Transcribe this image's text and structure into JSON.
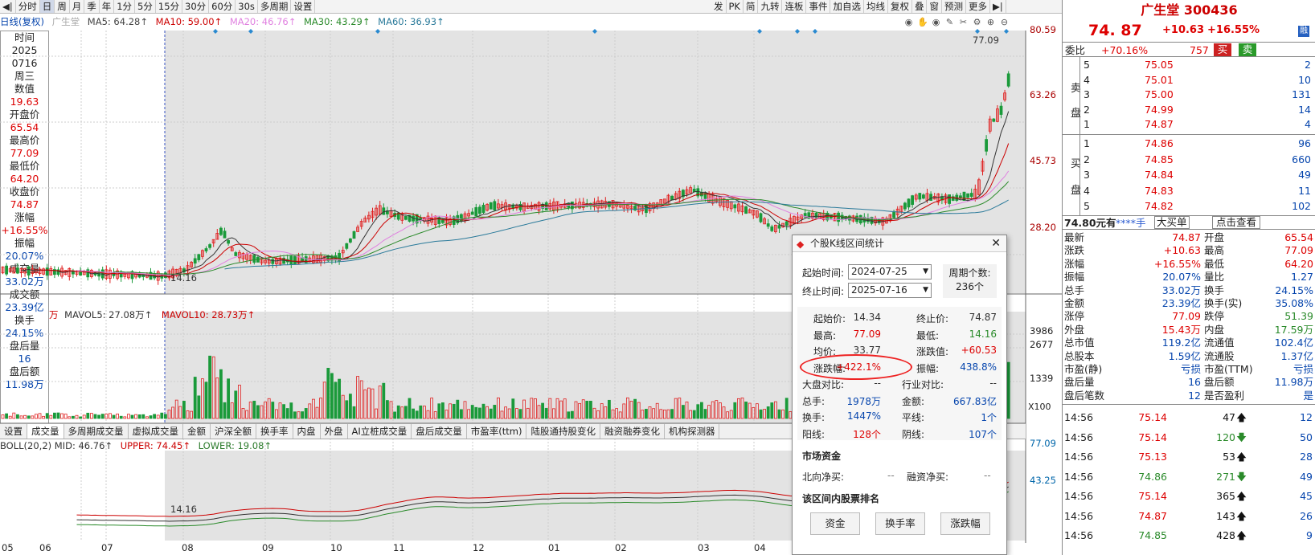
{
  "toolbar": {
    "items": [
      "分时",
      "日",
      "周",
      "月",
      "季",
      "年",
      "1分",
      "5分",
      "15分",
      "30分",
      "60分",
      "30s",
      "多周期",
      "设置"
    ],
    "active": "日",
    "right_items": [
      "发",
      "PK",
      "简",
      "九转",
      "连板",
      "事件",
      "加自选",
      "均线",
      "复权",
      "叠",
      "窗",
      "预测",
      "更多"
    ]
  },
  "stock": {
    "name": "广生堂",
    "code": "300436",
    "price": "74. 87",
    "change": "+10.63",
    "pct": "+16.55%",
    "tag": "融"
  },
  "ma_bar": {
    "label": "日线(复权)",
    "name": "广生堂",
    "ma5": "MA5: 64.28↑",
    "ma10": "MA10: 59.00↑",
    "ma20": "MA20: 46.76↑",
    "ma30": "MA30: 43.29↑",
    "ma60": "MA60: 36.93↑"
  },
  "left_info": [
    [
      "时间",
      ""
    ],
    [
      "2025",
      ""
    ],
    [
      "0716",
      ""
    ],
    [
      "周三",
      ""
    ],
    [
      "数值",
      ""
    ],
    [
      "19.63",
      "red"
    ],
    [
      "开盘价",
      ""
    ],
    [
      "65.54",
      "red"
    ],
    [
      "最高价",
      ""
    ],
    [
      "77.09",
      "red"
    ],
    [
      "最低价",
      ""
    ],
    [
      "64.20",
      "red"
    ],
    [
      "收盘价",
      ""
    ],
    [
      "74.87",
      "red"
    ],
    [
      "涨幅",
      ""
    ],
    [
      "+16.55%",
      "red"
    ],
    [
      "振幅",
      ""
    ],
    [
      "20.07%",
      "blue"
    ],
    [
      "成交量",
      ""
    ],
    [
      "33.02万",
      "blue"
    ],
    [
      "成交额",
      ""
    ],
    [
      "23.39亿",
      "blue"
    ],
    [
      "换手",
      ""
    ],
    [
      "24.15%",
      "blue"
    ],
    [
      "盘后量",
      ""
    ],
    [
      "16",
      "blue"
    ],
    [
      "盘后额",
      ""
    ],
    [
      "11.98万",
      "blue"
    ]
  ],
  "price_axis": [
    "80.59",
    "63.26",
    "45.73",
    "28.20"
  ],
  "price_annot": {
    "high": "77.09",
    "low": "14.16"
  },
  "vol_bar": {
    "unit": "万",
    "mavol5": "MAVOL5: 27.08万↑",
    "mavol10": "MAVOL10: 28.73万↑"
  },
  "vol_axis": [
    "3986",
    "2677",
    "1339"
  ],
  "vol_mult": "X100",
  "tabs": [
    "设置",
    "成交量",
    "多周期成交量",
    "虚拟成交量",
    "金额",
    "沪深全额",
    "换手率",
    "内盘",
    "外盘",
    "AI立桩成交量",
    "盘后成交量",
    "市盈率(ttm)",
    "陆股通持股变化",
    "融资融券变化",
    "机构探测器"
  ],
  "boll": {
    "mid": "BOLL(20,2) MID: 46.76↑",
    "upper": "UPPER: 74.45↑",
    "lower": "LOWER: 19.08↑",
    "axis": [
      "77.09",
      "43.25"
    ],
    "low": "14.16"
  },
  "dates": [
    "05",
    "06",
    "07",
    "08",
    "09",
    "10",
    "11",
    "12",
    "01",
    "02",
    "03",
    "04"
  ],
  "webi": {
    "label": "委比",
    "pct": "+70.16%",
    "diff": "757",
    "buy": "买",
    "sell": "卖"
  },
  "asks": [
    [
      "5",
      "75.05",
      "2"
    ],
    [
      "4",
      "75.01",
      "10"
    ],
    [
      "3",
      "75.00",
      "131"
    ],
    [
      "2",
      "74.99",
      "14"
    ],
    [
      "1",
      "74.87",
      "4"
    ]
  ],
  "bids": [
    [
      "1",
      "74.86",
      "96"
    ],
    [
      "2",
      "74.85",
      "660"
    ],
    [
      "3",
      "74.84",
      "49"
    ],
    [
      "4",
      "74.83",
      "11"
    ],
    [
      "5",
      "74.82",
      "102"
    ]
  ],
  "ask_label": [
    "卖",
    "盘"
  ],
  "bid_label": [
    "买",
    "盘"
  ],
  "lvl2": {
    "price": "74.80元有",
    "hidden": "****手",
    "big": "大买单",
    "link": "点击查看"
  },
  "stats": [
    [
      "最新",
      "74.87",
      "开盘",
      "65.54"
    ],
    [
      "涨跌",
      "+10.63",
      "最高",
      "77.09"
    ],
    [
      "涨幅",
      "+16.55%",
      "最低",
      "64.20"
    ],
    [
      "振幅",
      "20.07%",
      "量比",
      "1.27"
    ],
    [
      "总手",
      "33.02万",
      "换手",
      "24.15%"
    ],
    [
      "金额",
      "23.39亿",
      "换手(实)",
      "35.08%"
    ],
    [
      "涨停",
      "77.09",
      "跌停",
      "51.39"
    ],
    [
      "外盘",
      "15.43万",
      "内盘",
      "17.59万"
    ],
    [
      "总市值",
      "119.2亿",
      "流通值",
      "102.4亿"
    ],
    [
      "总股本",
      "1.59亿",
      "流通股",
      "1.37亿"
    ],
    [
      "市盈(静)",
      "亏损",
      "市盈(TTM)",
      "亏损"
    ],
    [
      "盘后量",
      "16",
      "盘后额",
      "11.98万"
    ],
    [
      "盘后笔数",
      "12",
      "是否盈利",
      "是"
    ]
  ],
  "ticks": [
    [
      "14:56",
      "75.14",
      "47",
      "up",
      "12"
    ],
    [
      "14:56",
      "75.14",
      "120",
      "down",
      "50"
    ],
    [
      "14:56",
      "75.13",
      "53",
      "up",
      "28"
    ],
    [
      "14:56",
      "74.86",
      "271",
      "down",
      "49"
    ],
    [
      "14:56",
      "75.14",
      "365",
      "up",
      "45"
    ],
    [
      "14:56",
      "74.87",
      "143",
      "up",
      "26"
    ],
    [
      "14:56",
      "74.85",
      "428",
      "up",
      "9"
    ]
  ],
  "dialog": {
    "title": "个股K线区间统计",
    "start_label": "起始时间:",
    "start": "2024-07-25",
    "end_label": "终止时间:",
    "end": "2025-07-16",
    "period_label": "周期个数:",
    "period": "236个",
    "rows": [
      [
        "起始价:",
        "14.34",
        "终止价:",
        "74.87"
      ],
      [
        "最高:",
        "77.09",
        "最低:",
        "14.16"
      ],
      [
        "均价:",
        "33.77",
        "涨跌值:",
        "+60.53"
      ],
      [
        "涨跌幅:",
        "+422.1%",
        "振幅:",
        "438.8%"
      ],
      [
        "大盘对比:",
        "--",
        "行业对比:",
        "--"
      ],
      [
        "总手:",
        "1978万",
        "金额:",
        "667.83亿"
      ],
      [
        "换手:",
        "1447%",
        "平线:",
        "1个"
      ],
      [
        "阳线:",
        "128个",
        "阴线:",
        "107个"
      ]
    ],
    "fund_title": "市场资金",
    "north": "北向净买:",
    "north_v": "--",
    "margin": "融资净买:",
    "margin_v": "--",
    "rank_title": "该区间内股票排名",
    "btns": [
      "资金",
      "换手率",
      "涨跌幅"
    ]
  }
}
